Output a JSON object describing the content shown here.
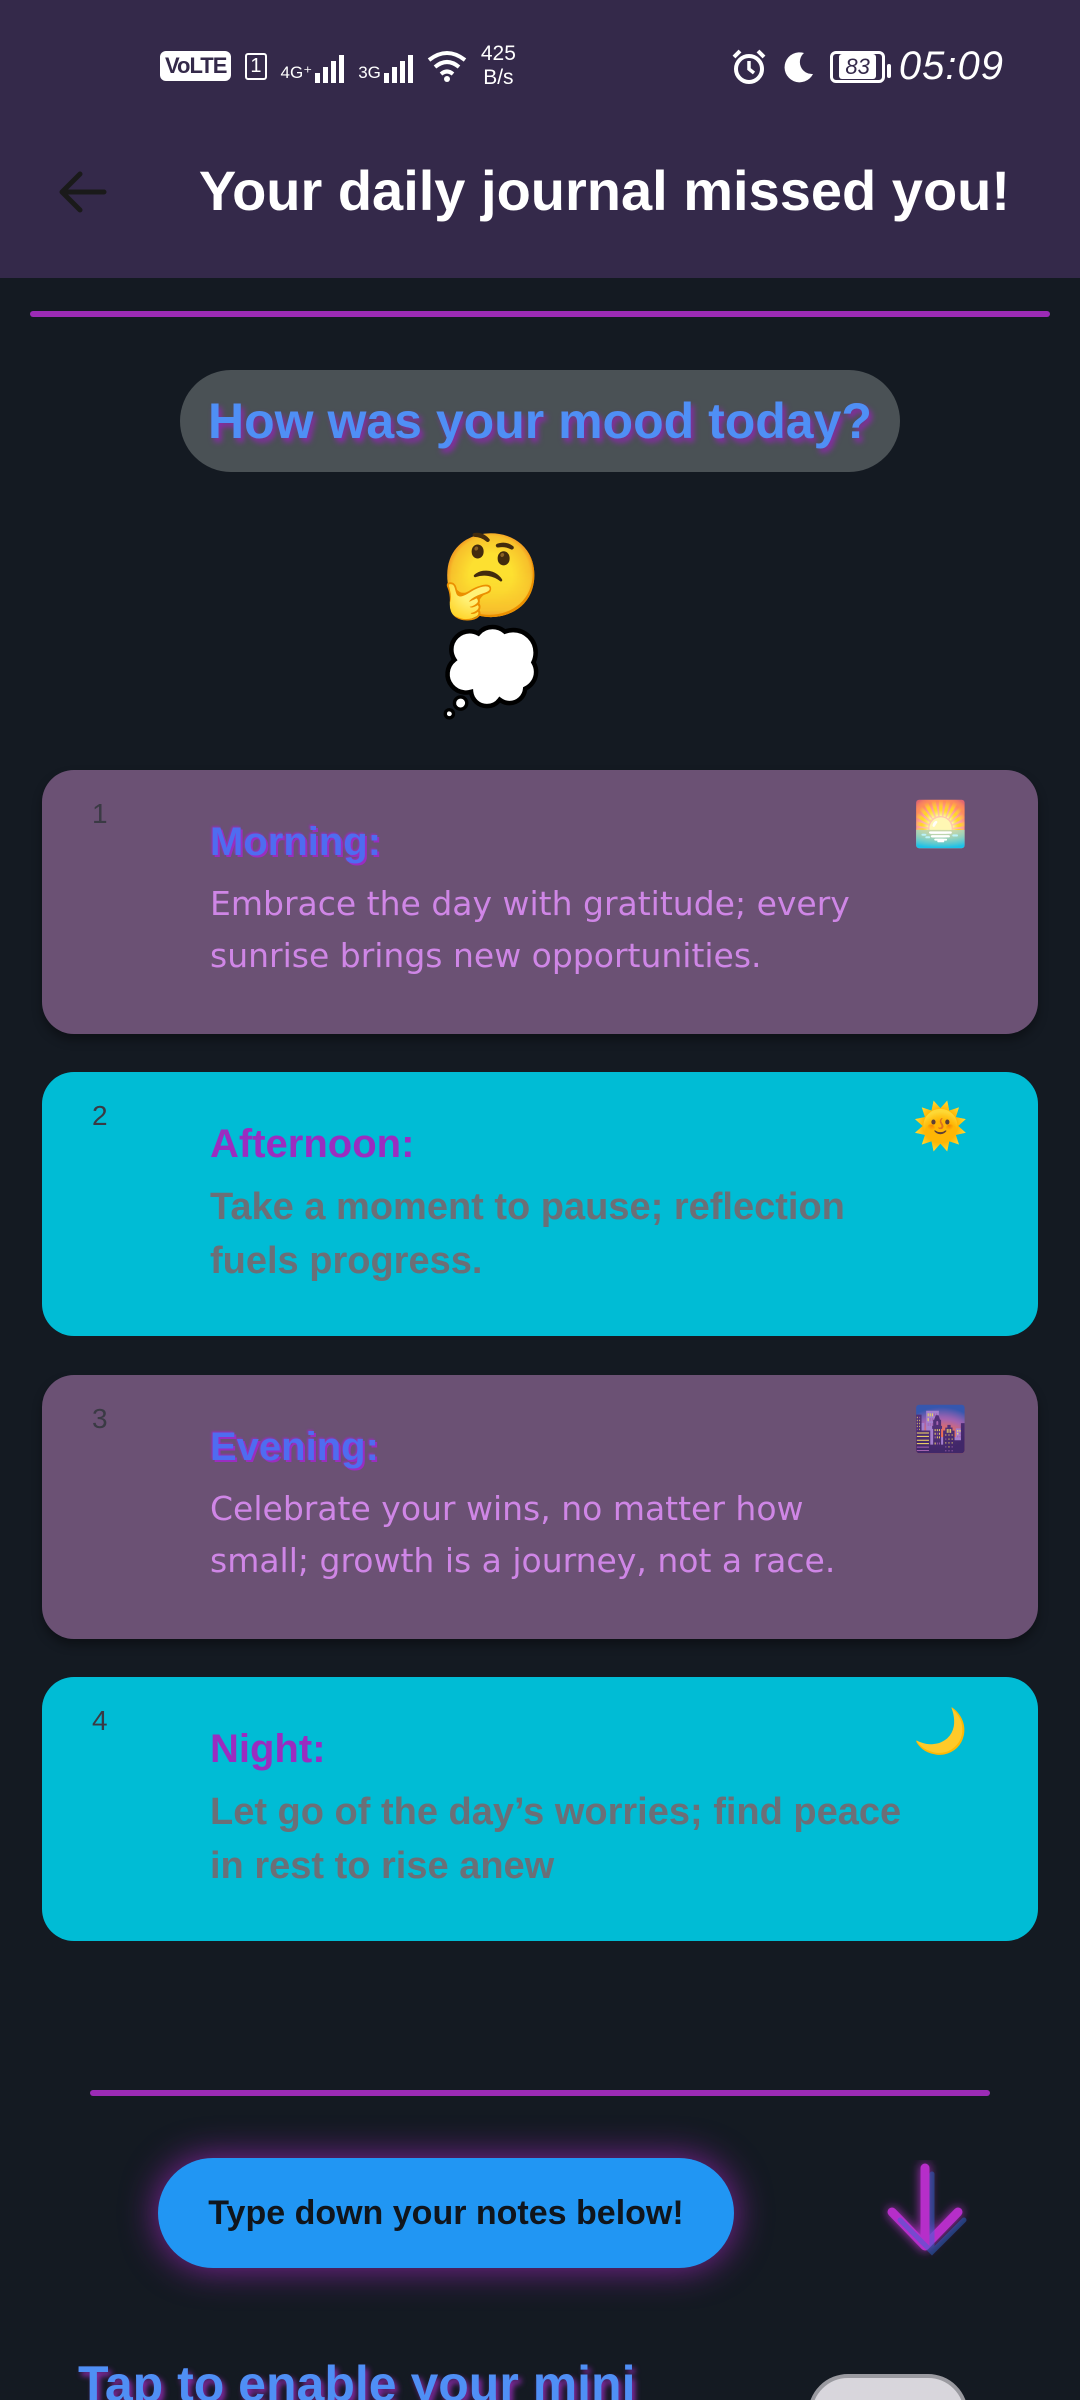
{
  "status_bar": {
    "volte": "VoLTE",
    "sim": "1",
    "net1": "4G⁺",
    "net2": "3G",
    "speed_value": "425",
    "speed_unit": "B/s",
    "battery": "83",
    "time": "05:09"
  },
  "header": {
    "back_icon": "arrow-left-icon",
    "title": "Your daily journal missed you!"
  },
  "mood": {
    "question": "How was your mood today?",
    "emoji": "🤔💭"
  },
  "entries": [
    {
      "number": "1",
      "title": "Morning:",
      "text": "Embrace the day with gratitude; every sunrise brings new opportunities.",
      "icon": "🌅",
      "style": "purple"
    },
    {
      "number": "2",
      "title": "Afternoon:",
      "text": "Take a moment to pause; reflection fuels progress.",
      "icon": "🌞",
      "style": "cyan"
    },
    {
      "number": "3",
      "title": "Evening:",
      "text": "Celebrate your wins, no matter how small; growth is a journey, not a race.",
      "icon": "🌆",
      "style": "purple"
    },
    {
      "number": "4",
      "title": "Night:",
      "text": "Let go of the day’s worries; find peace in rest to rise anew",
      "icon": "🌙",
      "style": "cyan"
    }
  ],
  "notes": {
    "button_label": "Type down your notes below!",
    "arrow_icon": "arrow-down-icon"
  },
  "mini": {
    "label": "Tap to enable your mini"
  },
  "colors": {
    "appbar": "#34294a",
    "background": "#141a22",
    "accent_purple": "#9c2bb5",
    "card_purple": "#6b5174",
    "card_cyan": "#00bcd5",
    "button_blue": "#2196f3"
  }
}
